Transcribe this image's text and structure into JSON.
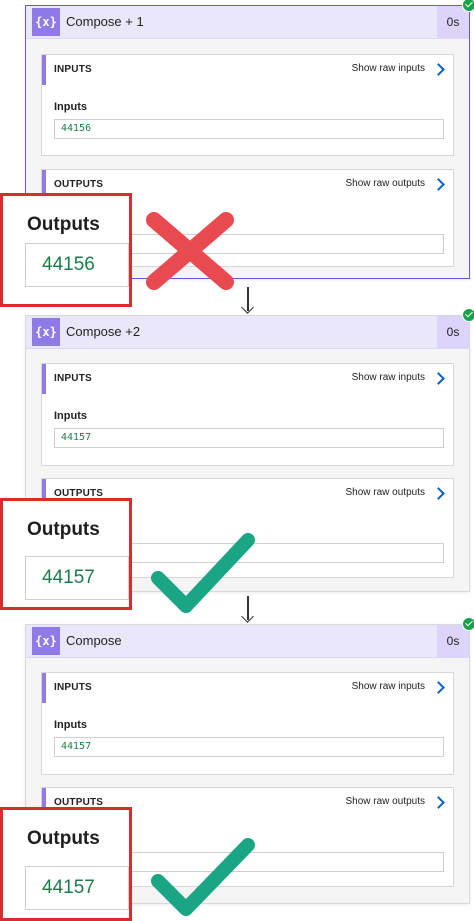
{
  "cards": [
    {
      "title": "Compose + 1",
      "duration": "0s",
      "inputs": {
        "section_title": "INPUTS",
        "show_raw": "Show raw inputs",
        "field_label": "Inputs",
        "field_value": "44156"
      },
      "outputs": {
        "section_title": "OUTPUTS",
        "show_raw": "Show raw outputs"
      }
    },
    {
      "title": "Compose +2",
      "duration": "0s",
      "inputs": {
        "section_title": "INPUTS",
        "show_raw": "Show raw inputs",
        "field_label": "Inputs",
        "field_value": "44157"
      },
      "outputs": {
        "section_title": "OUTPUTS",
        "show_raw": "Show raw outputs"
      }
    },
    {
      "title": "Compose",
      "duration": "0s",
      "inputs": {
        "section_title": "INPUTS",
        "show_raw": "Show raw inputs",
        "field_label": "Inputs",
        "field_value": "44157"
      },
      "outputs": {
        "section_title": "OUTPUTS",
        "show_raw": "Show raw outputs"
      }
    }
  ],
  "callouts": [
    {
      "title": "Outputs",
      "value": "44156"
    },
    {
      "title": "Outputs",
      "value": "44157"
    },
    {
      "title": "Outputs",
      "value": "44157"
    }
  ],
  "colors": {
    "accent": "#8f7ae8",
    "success": "#18a34a",
    "callout_border": "#d92d2d",
    "cross": "#e84a4f",
    "check": "#1aa584",
    "value_text": "#1d7d4a"
  },
  "icons": {
    "action": "{x}",
    "status": "check-circle-icon"
  }
}
